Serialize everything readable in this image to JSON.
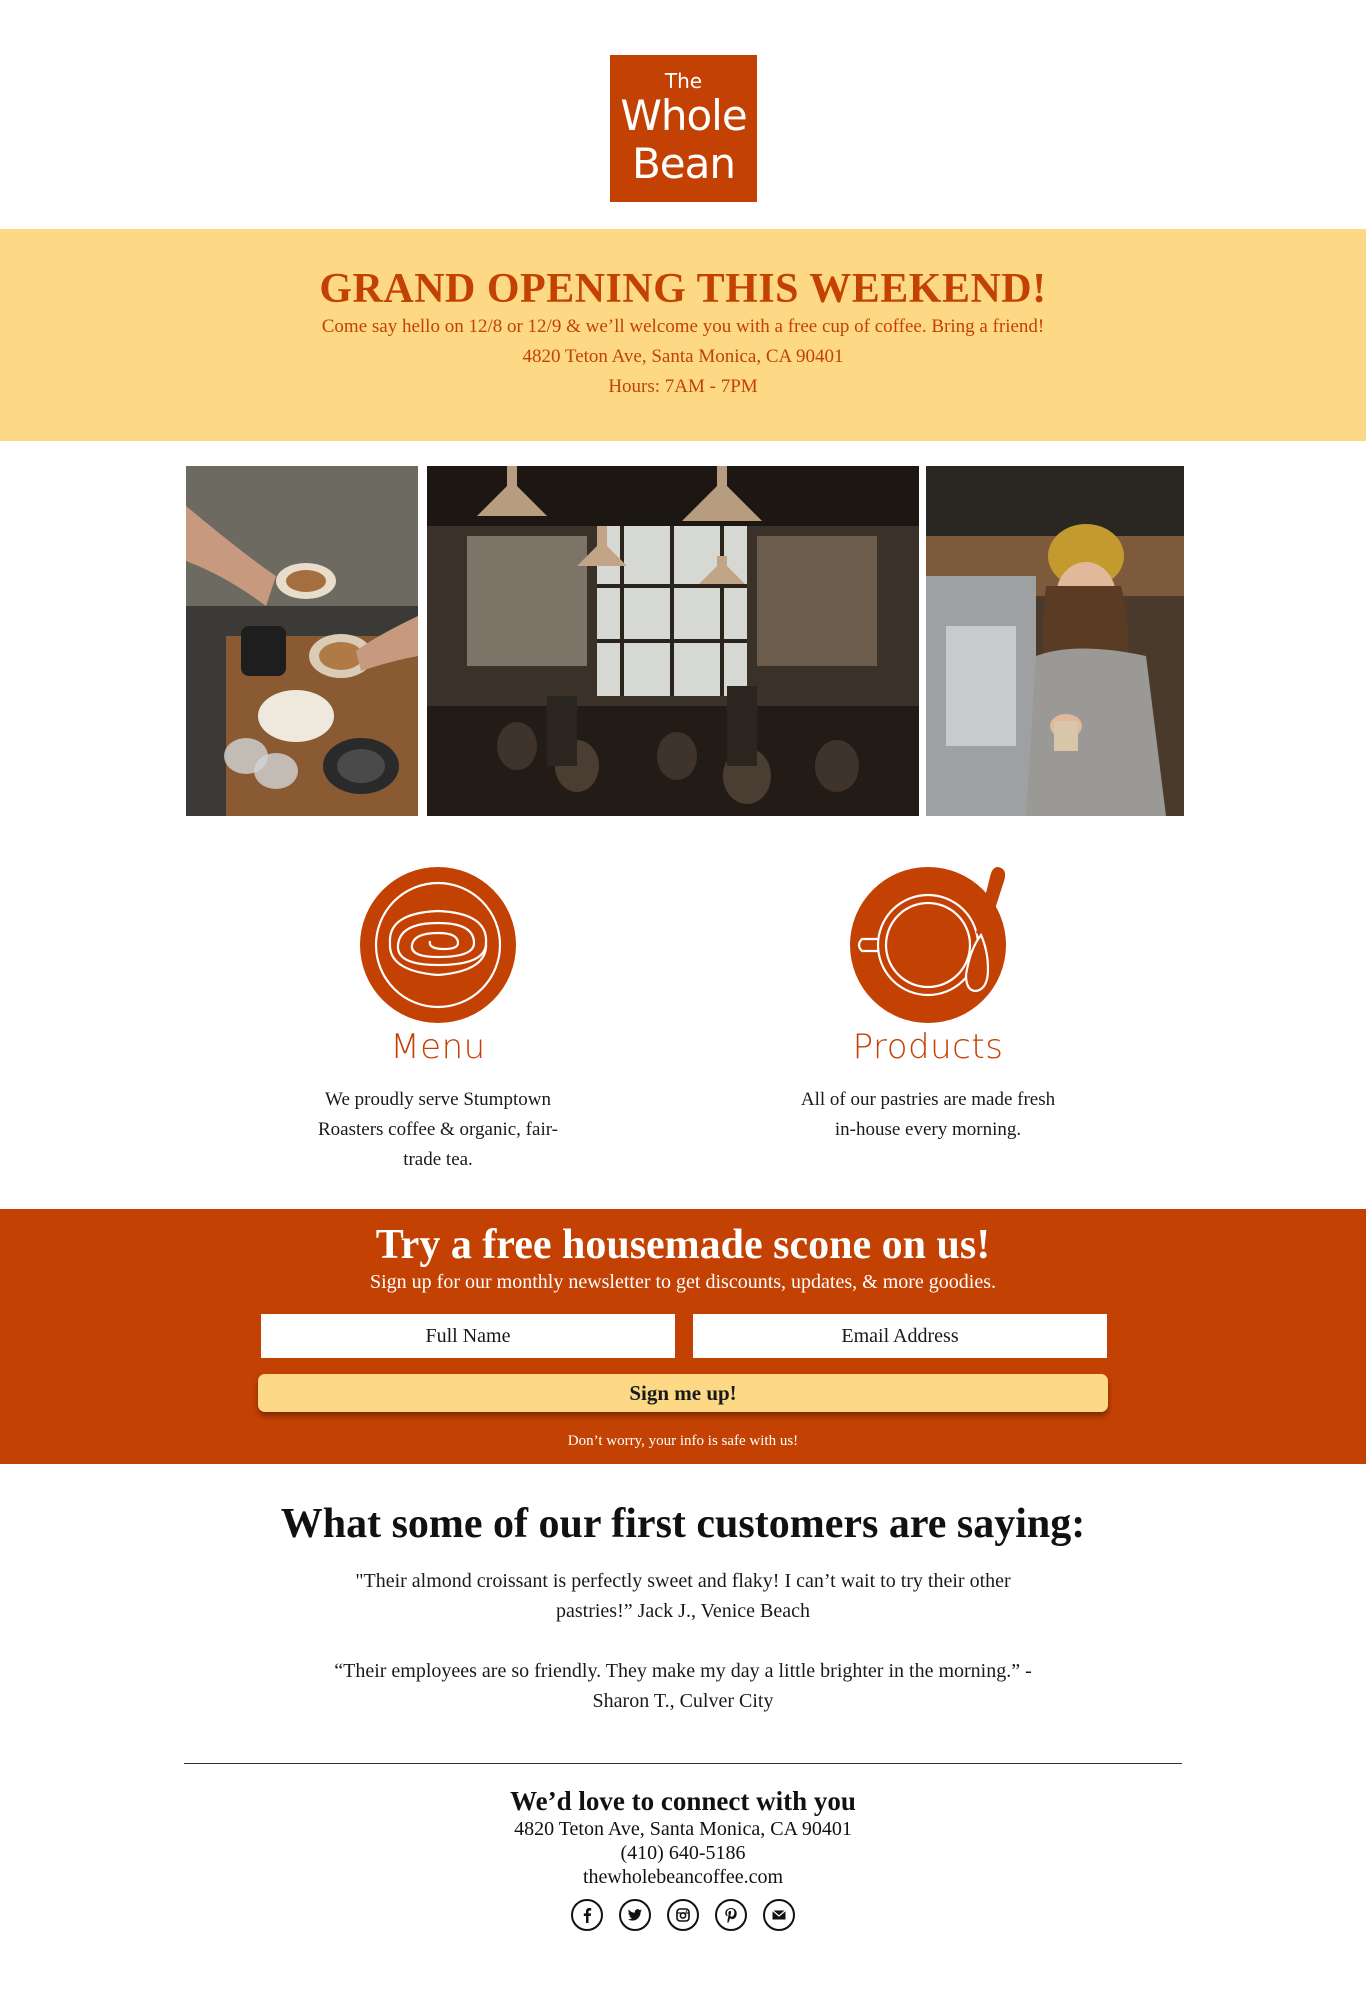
{
  "brand": {
    "logo_line1": "The",
    "logo_line2": "Whole",
    "logo_line3": "Bean",
    "accent_color": "#c44104",
    "banner_color": "#fdd985"
  },
  "announcement": {
    "headline": "GRAND OPENING THIS WEEKEND!",
    "line1": "Come say hello on 12/8 or 12/9 & we’ll welcome you with a free cup of coffee. Bring a friend!",
    "line2": "4820 Teton Ave, Santa Monica, CA 90401",
    "line3": "Hours: 7AM - 7PM"
  },
  "gallery": {
    "photos": [
      {
        "icon": "coffee-cups-photo"
      },
      {
        "icon": "cafe-interior-photo"
      },
      {
        "icon": "barista-photo"
      }
    ]
  },
  "features": [
    {
      "icon": "pastry-icon",
      "title": "Menu",
      "text": "We proudly serve Stumptown Roasters coffee & organic, fair-trade tea."
    },
    {
      "icon": "coffee-cup-icon",
      "title": "Products",
      "text": "All of our pastries are made fresh in-house every morning."
    }
  ],
  "newsletter": {
    "headline": "Try a free housemade scone on us!",
    "subline": "Sign up for our monthly newsletter to get discounts, updates, & more goodies.",
    "name_placeholder": "Full Name",
    "email_placeholder": "Email Address",
    "button_label": "Sign me up!",
    "note": "Don’t worry, your info is safe with us!"
  },
  "testimonials": {
    "heading": "What some of our first customers are saying:",
    "quotes": [
      "\"Their almond croissant is perfectly sweet and flaky! I can’t wait to try their other pastries!” Jack J., Venice Beach",
      "“Their employees are so friendly. They make my day a little brighter in the morning.” -Sharon T., Culver City"
    ]
  },
  "footer": {
    "title": "We’d love to connect with you",
    "address": "4820 Teton Ave, Santa Monica, CA 90401",
    "phone": "(410) 640-5186",
    "website": "thewholebeancoffee.com",
    "social": [
      {
        "icon": "facebook-icon"
      },
      {
        "icon": "twitter-icon"
      },
      {
        "icon": "instagram-icon"
      },
      {
        "icon": "pinterest-icon"
      },
      {
        "icon": "email-icon"
      }
    ]
  }
}
